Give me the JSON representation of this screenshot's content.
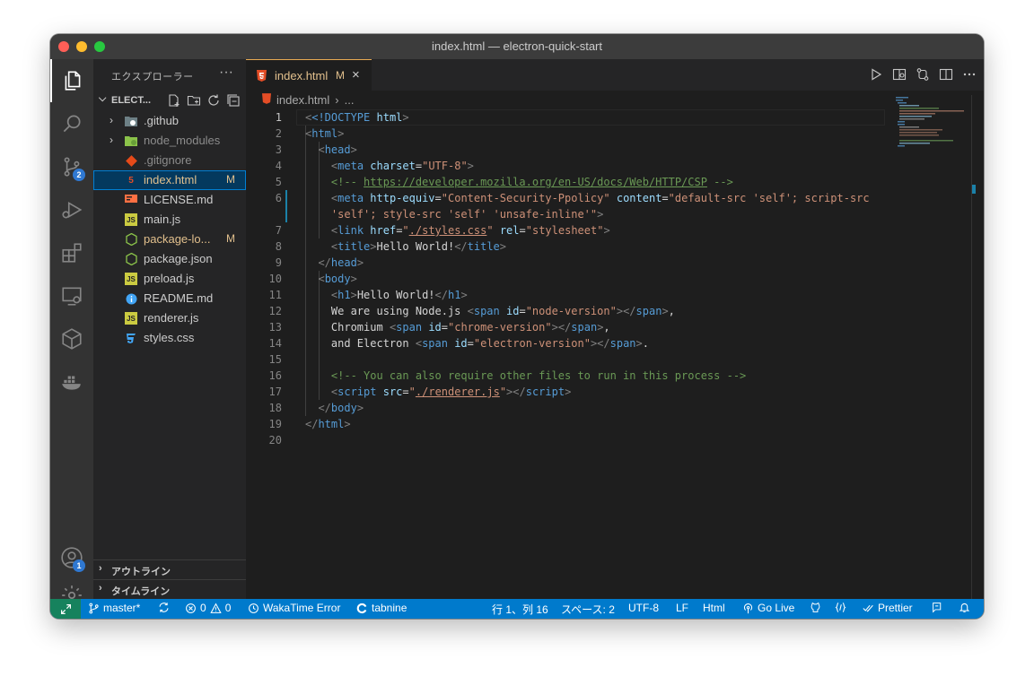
{
  "window": {
    "title": "index.html — electron-quick-start"
  },
  "activity_bar": {
    "items": [
      {
        "name": "explorer",
        "icon": "files-icon"
      },
      {
        "name": "search",
        "icon": "search-icon"
      },
      {
        "name": "source-control",
        "icon": "source-control-icon",
        "badge": "2"
      },
      {
        "name": "run-debug",
        "icon": "debug-icon"
      },
      {
        "name": "extensions",
        "icon": "extensions-icon"
      },
      {
        "name": "remote-explorer",
        "icon": "remote-explorer-icon"
      },
      {
        "name": "3d-box",
        "icon": "cube-icon"
      },
      {
        "name": "docker",
        "icon": "docker-icon"
      }
    ],
    "accounts_badge": "1"
  },
  "sidebar": {
    "header": "エクスプローラー",
    "folder": "ELECT...",
    "files": [
      {
        "name": ".github",
        "type": "folder",
        "status": ""
      },
      {
        "name": "node_modules",
        "type": "folder",
        "status": ""
      },
      {
        "name": ".gitignore",
        "type": "git",
        "status": ""
      },
      {
        "name": "index.html",
        "type": "html",
        "status": "M"
      },
      {
        "name": "LICENSE.md",
        "type": "license",
        "status": ""
      },
      {
        "name": "main.js",
        "type": "js",
        "status": ""
      },
      {
        "name": "package-lo...",
        "type": "node",
        "status": "M"
      },
      {
        "name": "package.json",
        "type": "node",
        "status": ""
      },
      {
        "name": "preload.js",
        "type": "js",
        "status": ""
      },
      {
        "name": "README.md",
        "type": "info",
        "status": ""
      },
      {
        "name": "renderer.js",
        "type": "js",
        "status": ""
      },
      {
        "name": "styles.css",
        "type": "css",
        "status": ""
      }
    ],
    "outline": "アウトライン",
    "timeline": "タイムライン"
  },
  "editor": {
    "tab": {
      "label": "index.html",
      "status": "M"
    },
    "breadcrumb": {
      "file": "index.html",
      "rest": "..."
    },
    "lines": [
      "1",
      "2",
      "3",
      "4",
      "5",
      "6",
      "",
      "7",
      "8",
      "9",
      "10",
      "11",
      "12",
      "13",
      "14",
      "15",
      "16",
      "17",
      "18",
      "19",
      "20"
    ],
    "code": {
      "l1_doctype": "<!DOCTYPE",
      "l1_html": "html",
      "l4_charset_val": "\"UTF-8\"",
      "l5_open": "<!-- ",
      "l5_url": "https://developer.mozilla.org/en-US/docs/Web/HTTP/CSP",
      "l5_close": " -->",
      "l6_equiv_val": "\"Content-Security-Ppolicy\"",
      "l6_content_val": "\"default-src 'self'; script-src",
      "l6b": "'self'; style-src 'self' 'unsafe-inline'\"",
      "l7_href_val": "./styles.css",
      "l7_rel_val": "\"stylesheet\"",
      "l8_title": "Hello World!",
      "l11_h1": "Hello World!",
      "l12_text": "We are using Node.js ",
      "l12_id": "\"node-version\"",
      "l13_text": "Chromium ",
      "l13_id": "\"chrome-version\"",
      "l14_text": "and Electron ",
      "l14_id": "\"electron-version\"",
      "l16_comment": "<!-- You can also require other files to run in this process -->",
      "l17_src": "./renderer.js"
    }
  },
  "statusbar": {
    "branch": "master*",
    "errors": "0",
    "warnings": "0",
    "wakatime": "WakaTime Error",
    "tabnine": "tabnine",
    "position": "行 1、列 16",
    "spaces": "スペース: 2",
    "encoding": "UTF-8",
    "eol": "LF",
    "language": "Html",
    "golive": "Go Live",
    "prettier": "Prettier"
  }
}
